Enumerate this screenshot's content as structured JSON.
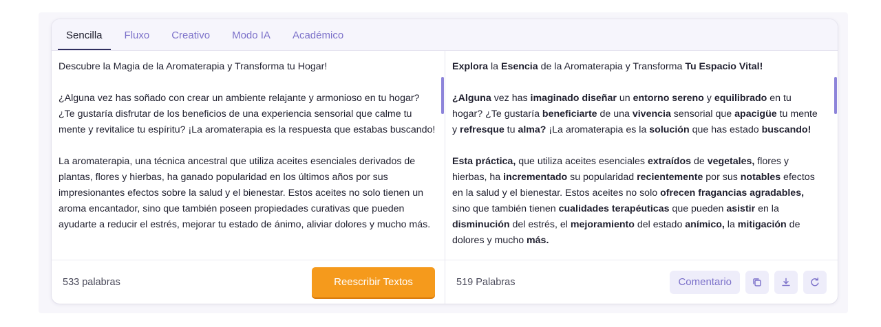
{
  "tabs": [
    {
      "label": "Sencilla",
      "active": true
    },
    {
      "label": "Fluxo",
      "active": false
    },
    {
      "label": "Creativo",
      "active": false
    },
    {
      "label": "Modo IA",
      "active": false
    },
    {
      "label": "Académico",
      "active": false
    }
  ],
  "input": {
    "paragraphs": [
      "Descubre la Magia de la Aromaterapia y Transforma tu Hogar!",
      "¿Alguna vez has soñado con crear un ambiente relajante y armonioso en tu hogar? ¿Te gustaría disfrutar de los beneficios de una experiencia sensorial que calme tu mente y revitalice tu espíritu? ¡La aromaterapia es la respuesta que estabas buscando!",
      "La aromaterapia, una técnica ancestral que utiliza aceites esenciales derivados de plantas, flores y hierbas, ha ganado popularidad en los últimos años por sus impresionantes efectos sobre la salud y el bienestar. Estos aceites no solo tienen un aroma encantador, sino que también poseen propiedades curativas que pueden ayudarte a reducir el estrés, mejorar tu estado de ánimo, aliviar dolores y mucho más."
    ],
    "word_count": "533 palabras",
    "rewrite_label": "Reescribir Textos"
  },
  "output": {
    "paragraphs": [
      [
        {
          "t": "Explora",
          "b": true
        },
        {
          "t": " la ",
          "b": false
        },
        {
          "t": "Esencia",
          "b": true
        },
        {
          "t": " de la Aromaterapia y Transforma ",
          "b": false
        },
        {
          "t": "Tu Espacio Vital!",
          "b": true
        }
      ],
      [
        {
          "t": "¿Alguna",
          "b": true
        },
        {
          "t": " vez has ",
          "b": false
        },
        {
          "t": "imaginado diseñar",
          "b": true
        },
        {
          "t": " un ",
          "b": false
        },
        {
          "t": "entorno sereno",
          "b": true
        },
        {
          "t": " y ",
          "b": false
        },
        {
          "t": "equilibrado",
          "b": true
        },
        {
          "t": " en tu hogar? ¿Te gustaría ",
          "b": false
        },
        {
          "t": "beneficiarte",
          "b": true
        },
        {
          "t": " de una ",
          "b": false
        },
        {
          "t": "vivencia",
          "b": true
        },
        {
          "t": " sensorial que ",
          "b": false
        },
        {
          "t": "apacigüe",
          "b": true
        },
        {
          "t": " tu mente y ",
          "b": false
        },
        {
          "t": "refresque",
          "b": true
        },
        {
          "t": " tu ",
          "b": false
        },
        {
          "t": "alma?",
          "b": true
        },
        {
          "t": " ¡La aromaterapia es la ",
          "b": false
        },
        {
          "t": "solución",
          "b": true
        },
        {
          "t": " que has estado ",
          "b": false
        },
        {
          "t": "buscando!",
          "b": true
        }
      ],
      [
        {
          "t": "Esta práctica,",
          "b": true
        },
        {
          "t": " que utiliza aceites esenciales ",
          "b": false
        },
        {
          "t": "extraídos",
          "b": true
        },
        {
          "t": " de ",
          "b": false
        },
        {
          "t": "vegetales,",
          "b": true
        },
        {
          "t": " flores y hierbas, ha ",
          "b": false
        },
        {
          "t": "incrementado",
          "b": true
        },
        {
          "t": " su popularidad ",
          "b": false
        },
        {
          "t": "recientemente",
          "b": true
        },
        {
          "t": " por sus ",
          "b": false
        },
        {
          "t": "notables",
          "b": true
        },
        {
          "t": " efectos en la salud y el bienestar. Estos aceites no solo ",
          "b": false
        },
        {
          "t": "ofrecen fragancias agradables,",
          "b": true
        },
        {
          "t": " sino que también tienen ",
          "b": false
        },
        {
          "t": "cualidades terapéuticas",
          "b": true
        },
        {
          "t": " que pueden ",
          "b": false
        },
        {
          "t": "asistir",
          "b": true
        },
        {
          "t": " en la ",
          "b": false
        },
        {
          "t": "disminución",
          "b": true
        },
        {
          "t": " del estrés, el ",
          "b": false
        },
        {
          "t": "mejoramiento",
          "b": true
        },
        {
          "t": " del estado ",
          "b": false
        },
        {
          "t": "anímico,",
          "b": true
        },
        {
          "t": " la ",
          "b": false
        },
        {
          "t": "mitigación",
          "b": true
        },
        {
          "t": " de dolores y mucho ",
          "b": false
        },
        {
          "t": "más.",
          "b": true
        }
      ]
    ],
    "word_count": "519 Palabras",
    "comment_label": "Comentario",
    "icons": [
      "copy-icon",
      "download-icon",
      "refresh-icon"
    ]
  },
  "colors": {
    "accent": "#7b70c9",
    "button_orange": "#f59a1c",
    "scrollbar": "#8d84da"
  }
}
